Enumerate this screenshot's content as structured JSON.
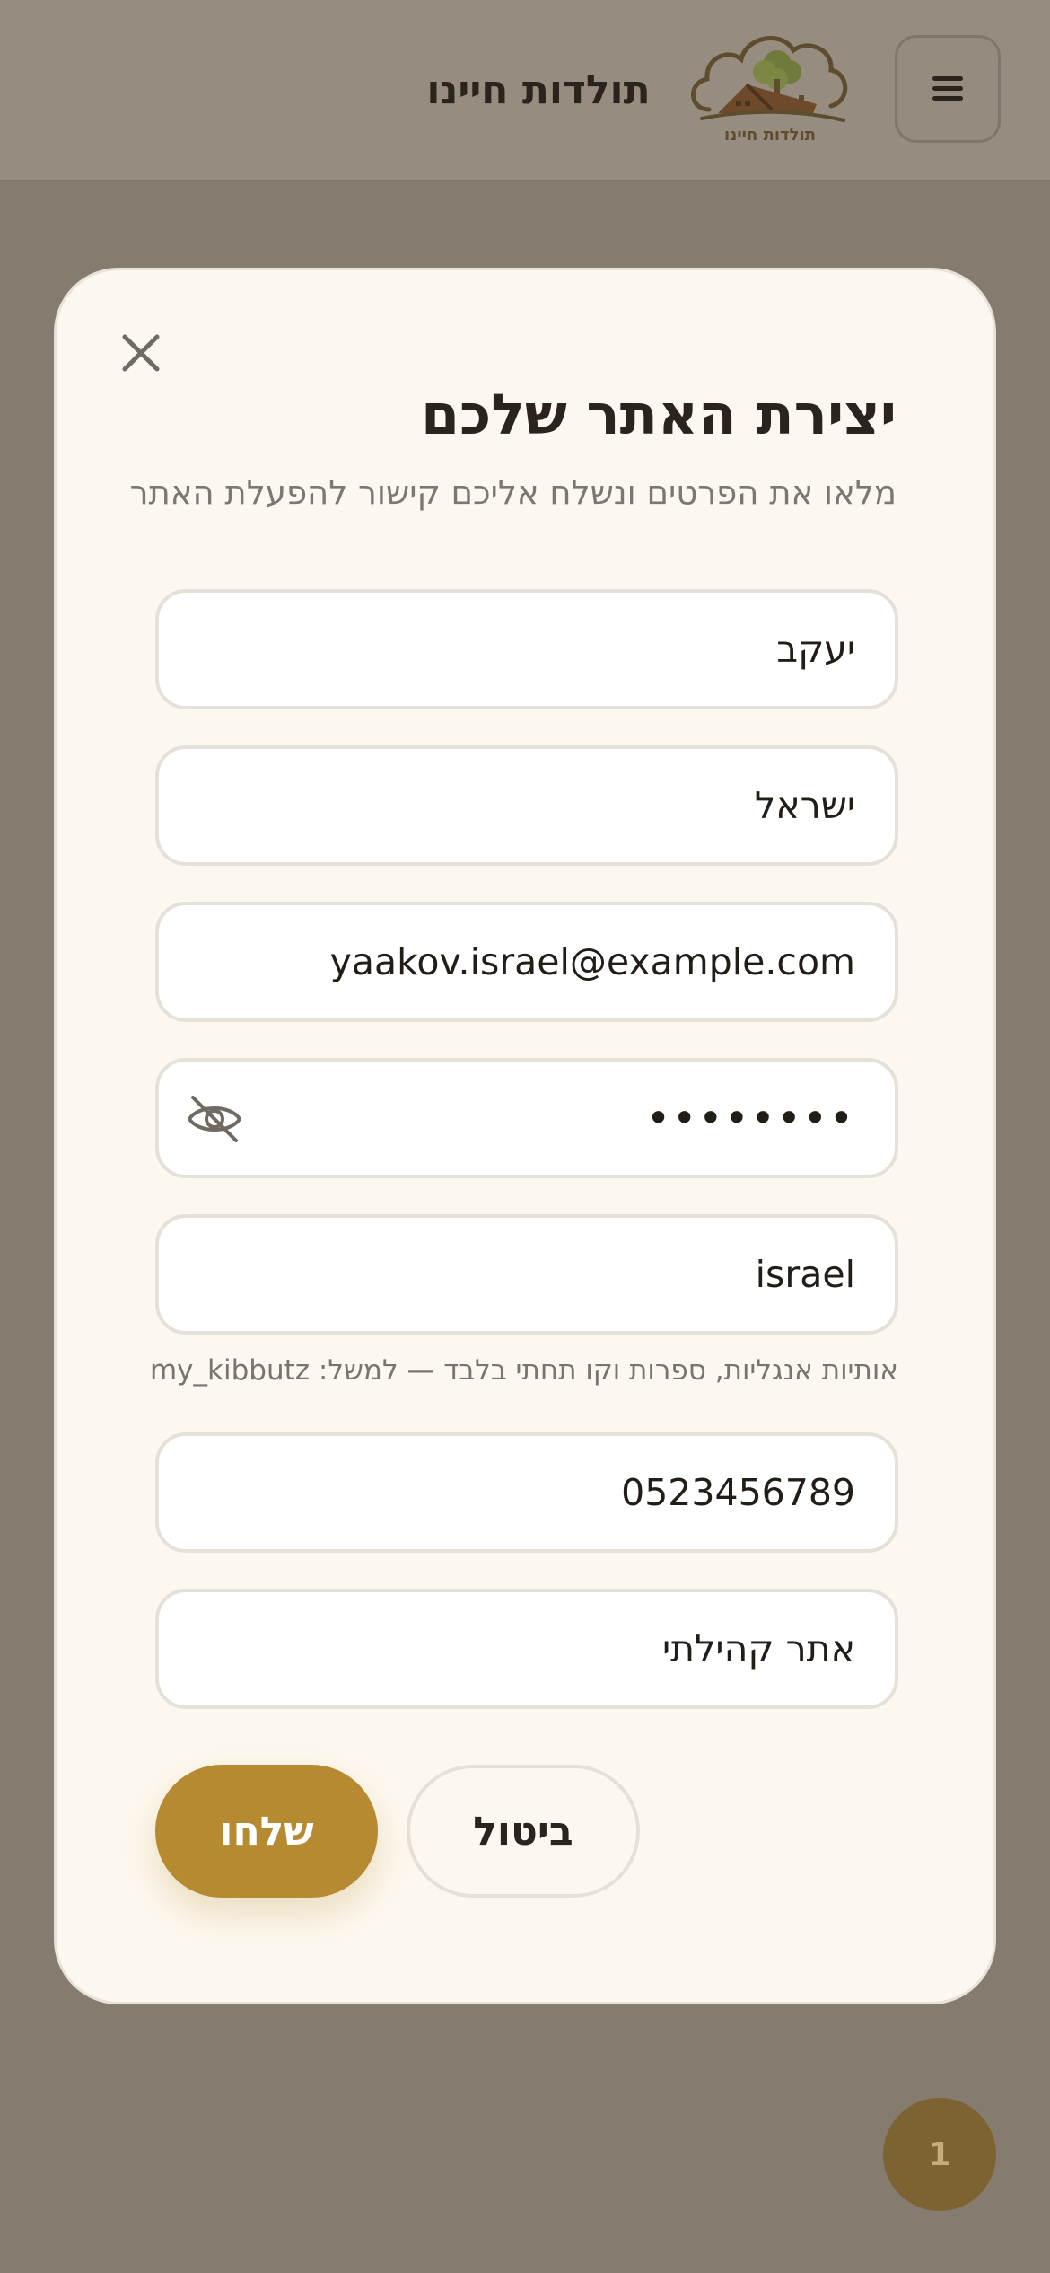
{
  "header": {
    "site_title": "תולדות חיינו",
    "logo_text": "תולדות חיינו",
    "menu_icon": "hamburger-icon"
  },
  "modal": {
    "title": "יצירת האתר שלכם",
    "subtitle": "מלאו את הפרטים ונשלח אליכם קישור להפעלת האתר",
    "close_icon": "close-icon",
    "fields": {
      "first_name": {
        "value": "יעקב"
      },
      "last_name": {
        "value": "ישראל"
      },
      "email": {
        "value": "yaakov.israel@example.com"
      },
      "password": {
        "value": "••••••••",
        "toggle_icon": "eye-off-icon"
      },
      "site_slug": {
        "value": "israel"
      },
      "phone": {
        "value": "0523456789"
      },
      "site_name": {
        "value": "אתר קהילתי"
      }
    },
    "slug_hint": "אותיות אנגליות, ספרות וקו תחתי בלבד — למשל: my_kibbutz",
    "submit_label": "שלחו",
    "cancel_label": "ביטול"
  },
  "fab": {
    "count": "1"
  },
  "colors": {
    "accent": "#b58a31",
    "modal_bg": "#fdf8ef",
    "overlay": "#857b6f",
    "text_dark": "#2a241c",
    "text_muted": "#7c7770"
  }
}
